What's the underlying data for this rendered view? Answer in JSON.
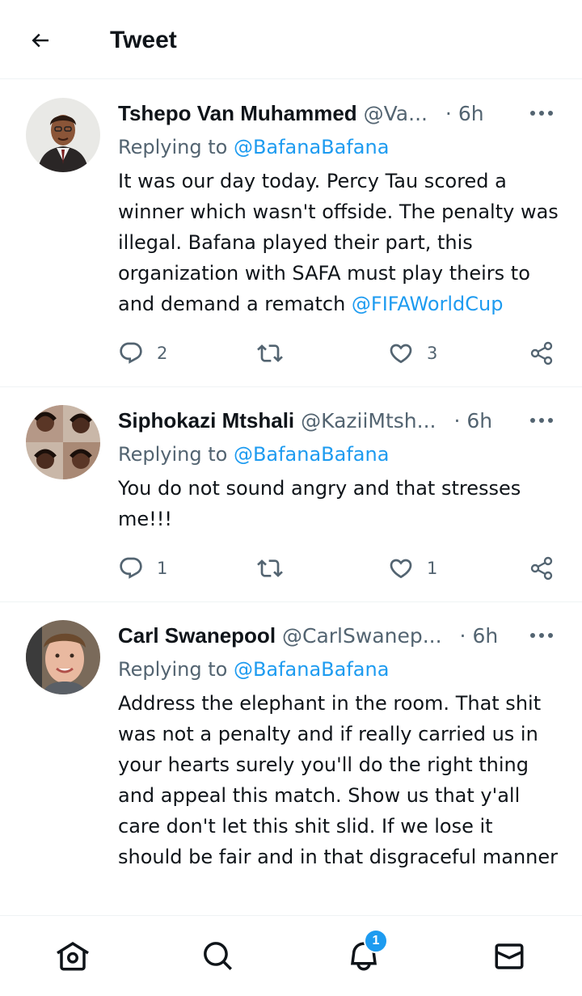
{
  "header": {
    "title": "Tweet",
    "back_icon": "arrow-left-icon"
  },
  "tweets": [
    {
      "name": "Tshepo Van Muhammed",
      "handle": "@Va...",
      "separator": "·",
      "time": "6h",
      "replying_prefix": "Replying to ",
      "replying_to": "@BafanaBafana",
      "text": "It was our day today. Percy Tau scored a winner which wasn't offside. The penalty was illegal. Bafana played their part, this organization with SAFA must play theirs to and demand a rematch ",
      "text_mention": "@FIFAWorldCup",
      "replies": "2",
      "retweets": "",
      "likes": "3"
    },
    {
      "name": "Siphokazi Mtshali",
      "handle": "@KaziiMtsh...",
      "separator": "·",
      "time": "6h",
      "replying_prefix": "Replying to ",
      "replying_to": "@BafanaBafana",
      "text": "You do not sound angry and that stresses me!!!",
      "text_mention": "",
      "replies": "1",
      "retweets": "",
      "likes": "1"
    },
    {
      "name": "Carl Swanepool",
      "handle": "@CarlSwanep...",
      "separator": "·",
      "time": "6h",
      "replying_prefix": "Replying to ",
      "replying_to": "@BafanaBafana",
      "text": "Address the elephant in the room. That shit was not a penalty and if really carried us in your hearts surely you'll do the right thing and appeal this match. Show us that y'all care don't let this shit slid. If we lose it should be fair and in that disgraceful manner",
      "text_mention": ""
    }
  ],
  "nav": {
    "items": [
      "home-icon",
      "search-icon",
      "notifications-icon",
      "messages-icon"
    ],
    "notification_count": "1"
  },
  "colors": {
    "accent": "#1d9bf0",
    "muted": "#536471",
    "text": "#0f1419",
    "border": "#eff3f4"
  }
}
